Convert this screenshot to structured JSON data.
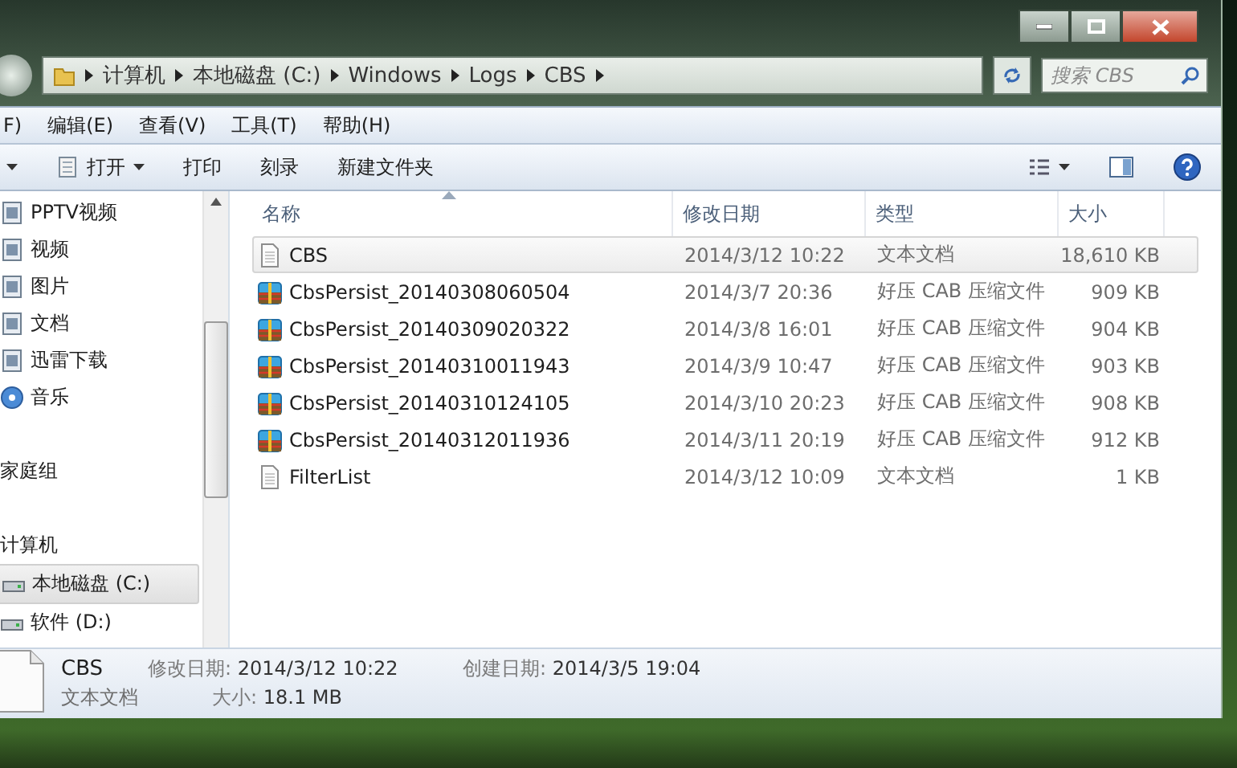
{
  "address": {
    "crumbs": [
      "计算机",
      "本地磁盘 (C:)",
      "Windows",
      "Logs",
      "CBS"
    ]
  },
  "search": {
    "placeholder": "搜索 CBS"
  },
  "menu": [
    "F)",
    "编辑(E)",
    "查看(V)",
    "工具(T)",
    "帮助(H)"
  ],
  "toolbar": [
    {
      "label": "打开",
      "kind": "dropdown"
    },
    {
      "label": "打印",
      "kind": "plain"
    },
    {
      "label": "刻录",
      "kind": "plain"
    },
    {
      "label": "新建文件夹",
      "kind": "plain"
    }
  ],
  "sidebar": {
    "items": [
      {
        "label": "PPTV视频",
        "kind": "library",
        "selected": false
      },
      {
        "label": "视频",
        "kind": "library",
        "selected": false
      },
      {
        "label": "图片",
        "kind": "library",
        "selected": false
      },
      {
        "label": "文档",
        "kind": "library",
        "selected": false
      },
      {
        "label": "迅雷下载",
        "kind": "library",
        "selected": false
      },
      {
        "label": "音乐",
        "kind": "music",
        "selected": false
      },
      {
        "label": "家庭组",
        "kind": "group",
        "selected": false
      },
      {
        "label": "计算机",
        "kind": "group",
        "selected": false
      },
      {
        "label": "本地磁盘 (C:)",
        "kind": "drive",
        "selected": true
      },
      {
        "label": "软件 (D:)",
        "kind": "drive",
        "selected": false
      }
    ]
  },
  "table": {
    "columns": [
      {
        "label": "名称",
        "sorted": true
      },
      {
        "label": "修改日期",
        "sorted": false
      },
      {
        "label": "类型",
        "sorted": false
      },
      {
        "label": "大小",
        "sorted": false
      }
    ],
    "rows": [
      {
        "name": "CBS",
        "date": "2014/3/12 10:22",
        "type": "文本文档",
        "size": "18,610 KB",
        "kind": "text",
        "selected": true
      },
      {
        "name": "CbsPersist_20140308060504",
        "date": "2014/3/7 20:36",
        "type": "好压 CAB 压缩文件",
        "size": "909 KB",
        "kind": "cab",
        "selected": false
      },
      {
        "name": "CbsPersist_20140309020322",
        "date": "2014/3/8 16:01",
        "type": "好压 CAB 压缩文件",
        "size": "904 KB",
        "kind": "cab",
        "selected": false
      },
      {
        "name": "CbsPersist_20140310011943",
        "date": "2014/3/9 10:47",
        "type": "好压 CAB 压缩文件",
        "size": "903 KB",
        "kind": "cab",
        "selected": false
      },
      {
        "name": "CbsPersist_20140310124105",
        "date": "2014/3/10 20:23",
        "type": "好压 CAB 压缩文件",
        "size": "908 KB",
        "kind": "cab",
        "selected": false
      },
      {
        "name": "CbsPersist_20140312011936",
        "date": "2014/3/11 20:19",
        "type": "好压 CAB 压缩文件",
        "size": "912 KB",
        "kind": "cab",
        "selected": false
      },
      {
        "name": "FilterList",
        "date": "2014/3/12 10:09",
        "type": "文本文档",
        "size": "1 KB",
        "kind": "text",
        "selected": false
      }
    ]
  },
  "details": {
    "name": "CBS",
    "type": "文本文档",
    "fields": [
      {
        "label": "修改日期:",
        "value": "2014/3/12 10:22"
      },
      {
        "label": "大小:",
        "value": "18.1 MB"
      },
      {
        "label": "创建日期:",
        "value": "2014/3/5 19:04"
      }
    ]
  }
}
